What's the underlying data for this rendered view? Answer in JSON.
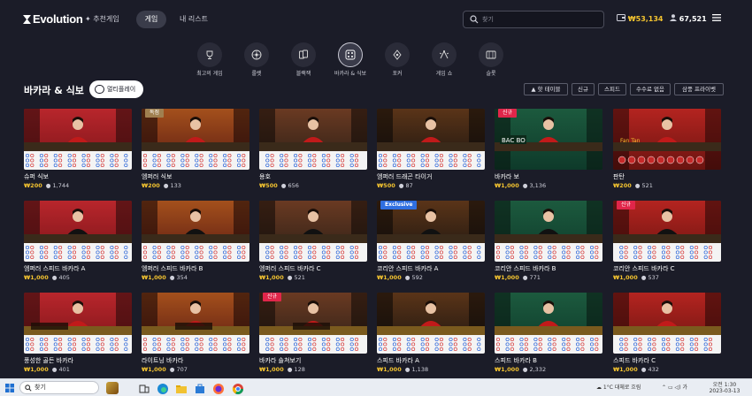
{
  "header": {
    "logo": "Evolution",
    "nav": {
      "recommend": "추천게임",
      "games": "게임",
      "mylist": "내 리스트"
    },
    "search_placeholder": "찾기",
    "balance": "₩53,134",
    "players": "67,521"
  },
  "categories": [
    {
      "label": "최고의 게임",
      "icon": "trophy-icon"
    },
    {
      "label": "룰렛",
      "icon": "roulette-icon"
    },
    {
      "label": "블랙잭",
      "icon": "cards-icon"
    },
    {
      "label": "바카라 & 식보",
      "icon": "baccarat-icon",
      "active": true
    },
    {
      "label": "포커",
      "icon": "poker-icon"
    },
    {
      "label": "게임 쇼",
      "icon": "game-show-icon"
    },
    {
      "label": "슬롯",
      "icon": "slot-icon"
    }
  ],
  "section": {
    "title": "바카라 & 식보",
    "multiplay": "멀티플레이",
    "filters": [
      "핫 테이블",
      "신규",
      "스피드",
      "수수료 없음",
      "삼풍 프라이벳"
    ]
  },
  "games": [
    {
      "name": "슈퍼 식보",
      "bet": "₩200",
      "players": "1,744",
      "badge": "",
      "scene": "sicbo"
    },
    {
      "name": "엠퍼러 식보",
      "bet": "₩200",
      "players": "133",
      "badge": "독점",
      "scene": "emperor"
    },
    {
      "name": "용호",
      "bet": "₩500",
      "players": "656",
      "badge": "",
      "scene": "dragon"
    },
    {
      "name": "엠퍼러 드래곤 타이거",
      "bet": "₩500",
      "players": "87",
      "badge": "",
      "scene": "dragontiger"
    },
    {
      "name": "바카라 보",
      "bet": "₩1,000",
      "players": "3,136",
      "badge": "신규",
      "scene": "bacbo"
    },
    {
      "name": "판탄",
      "bet": "₩200",
      "players": "521",
      "badge": "",
      "scene": "fantan"
    },
    {
      "name": "엠퍼러 스피드 바카라 A",
      "bet": "₩1,000",
      "players": "405",
      "badge": "",
      "scene": "speedA"
    },
    {
      "name": "엠퍼러 스피드 바카라 B",
      "bet": "₩1,000",
      "players": "354",
      "badge": "",
      "scene": "speedB"
    },
    {
      "name": "엠퍼러 스피드 바카라 C",
      "bet": "₩1,000",
      "players": "521",
      "badge": "",
      "scene": "speedC"
    },
    {
      "name": "코리안 스피드 바카라 A",
      "bet": "₩1,000",
      "players": "592",
      "badge": "Exclusive",
      "scene": "koreanA"
    },
    {
      "name": "코리안 스피드 바카라 B",
      "bet": "₩1,000",
      "players": "771",
      "badge": "",
      "scene": "koreanB"
    },
    {
      "name": "코리안 스피드 바카라 C",
      "bet": "₩1,000",
      "players": "537",
      "badge": "신규",
      "scene": "koreanC"
    },
    {
      "name": "풍성한 골든 바카라",
      "bet": "₩1,000",
      "players": "401",
      "badge": "",
      "scene": "golden"
    },
    {
      "name": "라이트닝 바카라",
      "bet": "₩1,000",
      "players": "707",
      "badge": "",
      "scene": "lightning"
    },
    {
      "name": "바카라 숄쳐보기",
      "bet": "₩1,000",
      "players": "128",
      "badge": "신규",
      "scene": "squeeze"
    },
    {
      "name": "스피드 바카라 A",
      "bet": "₩1,000",
      "players": "1,138",
      "badge": "",
      "scene": "speedA2"
    },
    {
      "name": "스피드 바카라 B",
      "bet": "₩1,000",
      "players": "2,332",
      "badge": "",
      "scene": "speedB2"
    },
    {
      "name": "스피드 바카라 C",
      "bet": "₩1,000",
      "players": "432",
      "badge": "",
      "scene": "speedC2"
    }
  ],
  "taskbar": {
    "search": "찾기",
    "weather": "1°C  대체로 흐림",
    "time": "오전 1:30",
    "date": "2023-03-13"
  },
  "colors": {
    "accent_gold": "#f4c430",
    "badge_new": "#e0264a",
    "badge_exclusive": "#2f6fe0",
    "background": "#1b1c28"
  }
}
